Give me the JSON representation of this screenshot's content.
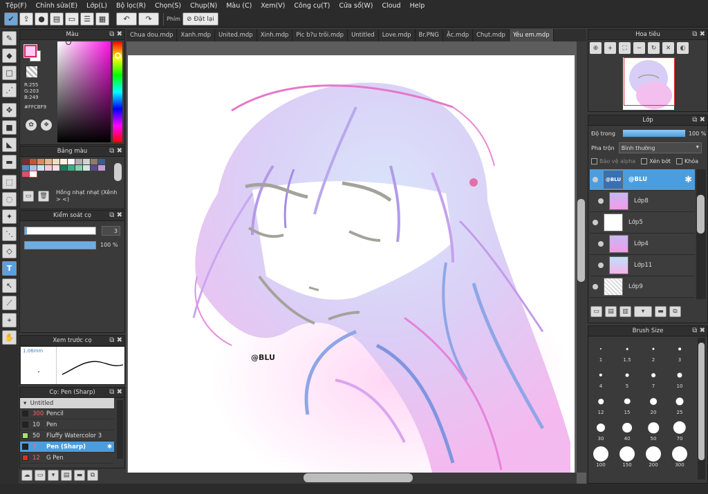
{
  "menu": [
    "Tệp(F)",
    "Chỉnh sửa(E)",
    "Lớp(L)",
    "Bộ lọc(R)",
    "Chọn(S)",
    "Chụp(N)",
    "Màu (C)",
    "Xem(V)",
    "Công cụ(T)",
    "Cửa sổ(W)",
    "Cloud",
    "Help"
  ],
  "toolbar": {
    "stab_label": "Phím",
    "stab_button": "Đặt lại"
  },
  "tabs": [
    "Chua dou.mdp",
    "Xanh.mdp",
    "United.mdp",
    "Xinh.mdp",
    "Pic b?u trôi.mdp",
    "Untitled",
    "Love.mdp",
    "Br.PNG",
    "Ặc.mdp",
    "Chụt.mdp",
    "Yêu em.mdp"
  ],
  "active_tab": 10,
  "color": {
    "title": "Màu",
    "r": "R:255",
    "g": "G:203",
    "b": "B:249",
    "hex": "#FFCBF9",
    "fg": "#FFCBF9"
  },
  "palette": {
    "title": "Bảng màu",
    "colors": [
      "#7a2b2b",
      "#c2572f",
      "#d98a5f",
      "#e7b88f",
      "#f4dcbf",
      "#fff3d9",
      "#ffffff",
      "#b0b0b0",
      "#d2d2d2",
      "#8e7b6d",
      "#3d5c8a",
      "#5a87c2",
      "#a1c6ea",
      "#cce3f5",
      "#f4c9d6",
      "#ffdce6",
      "#1f7a5c",
      "#3fae88",
      "#84d2b0",
      "#cfe9dd",
      "#5b4b8a",
      "#c39bd3",
      "#e14d6f",
      "#ffffff"
    ],
    "selected_name": "Hồng nhạt nhạt (Xênh > <)"
  },
  "brush_control": {
    "title": "Kiểm soát cọ",
    "size": "3",
    "opacity": "100 %",
    "size_fraction": 0.03,
    "opacity_fraction": 1.0
  },
  "brush_preview": {
    "title": "Xem trước cọ",
    "size_text": "1.06mm"
  },
  "brush_list": {
    "title": "Cọ: Pen (Sharp)",
    "group": "Untitled",
    "items": [
      {
        "size": "300",
        "name": "Pencil",
        "color": "#222222",
        "size_color": "#ff6666"
      },
      {
        "size": "10",
        "name": "Pen",
        "color": "#222222",
        "size_color": "#dddddd"
      },
      {
        "size": "50",
        "name": "Fluffy Watercolor 3",
        "color": "#a6e26b",
        "size_color": "#dddddd"
      },
      {
        "size": "3",
        "name": "Pen (Sharp)",
        "color": "#222222",
        "size_color": "#ff6666",
        "selected": true
      },
      {
        "size": "12",
        "name": "G Pen",
        "color": "#e22b2b",
        "size_color": "#ff6666"
      }
    ]
  },
  "navigator": {
    "title": "Hoa tiêu"
  },
  "layers": {
    "title": "Lớp",
    "opacity_label": "Độ trong",
    "opacity_value": "100 %",
    "blend_label": "Pha trộn",
    "blend_value": "Bình thường",
    "protect_alpha": "Bảo vệ alpha",
    "clipping": "Xén bớt",
    "lock": "Khóa",
    "items": [
      {
        "name": "@BLU",
        "thumb": "name",
        "selected": true,
        "indent": false,
        "thumb_text": "@BLU"
      },
      {
        "name": "Lớp8",
        "thumb": "grad",
        "indent": true
      },
      {
        "name": "Lớp5",
        "thumb": "sketch",
        "indent": false
      },
      {
        "name": "Lớp4",
        "thumb": "grad",
        "indent": true
      },
      {
        "name": "Lớp11",
        "thumb": "grad2",
        "indent": true
      },
      {
        "name": "Lớp9",
        "thumb": "check",
        "indent": false
      }
    ]
  },
  "brush_size": {
    "title": "Brush Size",
    "sizes": [
      "1",
      "1.5",
      "2",
      "3",
      "4",
      "5",
      "7",
      "10",
      "12",
      "15",
      "20",
      "25",
      "30",
      "40",
      "50",
      "70",
      "100",
      "150",
      "200",
      "300"
    ]
  },
  "canvas": {
    "signature": "@BLU"
  }
}
